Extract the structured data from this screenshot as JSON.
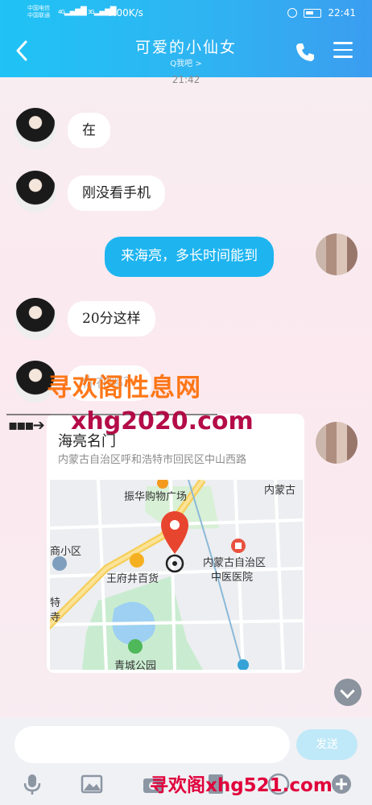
{
  "status_bar": {
    "carrier1": "中国电信",
    "carrier2": "中国联通",
    "signal1": "4G",
    "signal2": "3G",
    "net_speed": "0.00K/s",
    "battery": "100",
    "clock": "22:41"
  },
  "header": {
    "title": "可爱的小仙女",
    "subtitle": "Q我吧 >"
  },
  "chat": {
    "timestamp": "21:42",
    "messages": [
      {
        "from": "them",
        "text": "在"
      },
      {
        "from": "them",
        "text": "刚没看手机"
      },
      {
        "from": "me",
        "text": "来海亮，多长时间能到"
      },
      {
        "from": "them",
        "text": "20分这样"
      },
      {
        "from": "them",
        "text": "你在哪？"
      }
    ]
  },
  "location": {
    "name": "海亮名门",
    "address": "内蒙古自治区呼和浩特市回民区中山西路",
    "map_labels": [
      "振华购物广场",
      "内蒙古",
      "商小区",
      "王府井百货",
      "内蒙古自治区",
      "中医医院",
      "青城公园",
      "特",
      "寺"
    ]
  },
  "watermarks": {
    "w1": "寻欢阁性息网",
    "w2": "xhg2020.com",
    "w3": "寻欢阁xhg521.com"
  },
  "composer": {
    "placeholder": "",
    "send_label": "发送"
  },
  "colors": {
    "header_start": "#1fc3f5",
    "header_end": "#3b9df0",
    "my_bubble": "#1eb4f0",
    "pin": "#e8452f"
  }
}
